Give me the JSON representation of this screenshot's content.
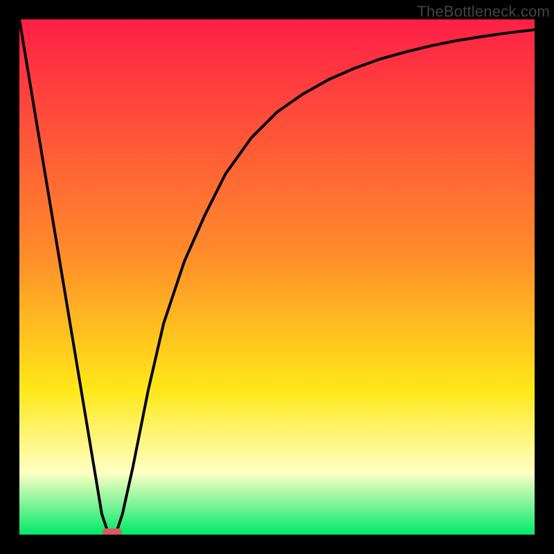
{
  "watermark": "TheBottleneck.com",
  "gradient": {
    "top": "#ff1f46",
    "mid1": "#ff8a2b",
    "mid2": "#ffe817",
    "light": "#feffc4",
    "bottom": "#00e96a"
  },
  "marker": {
    "fill": "#d55b60"
  },
  "chart_data": {
    "type": "line",
    "title": "",
    "xlabel": "",
    "ylabel": "",
    "xlim": [
      0,
      100
    ],
    "ylim": [
      0,
      100
    ],
    "x": [
      0,
      3,
      6,
      9,
      12,
      15,
      16,
      17,
      18,
      19,
      20,
      22,
      25,
      28,
      32,
      36,
      40,
      45,
      50,
      55,
      60,
      65,
      70,
      75,
      80,
      85,
      90,
      95,
      100
    ],
    "values": [
      100,
      82,
      64,
      46,
      28,
      10,
      4,
      1,
      0,
      1,
      4,
      13,
      28,
      41,
      53,
      62,
      70,
      77,
      82,
      85.5,
      88.3,
      90.5,
      92.3,
      93.7,
      94.9,
      95.9,
      96.7,
      97.4,
      98
    ],
    "optimum_x": 18
  }
}
